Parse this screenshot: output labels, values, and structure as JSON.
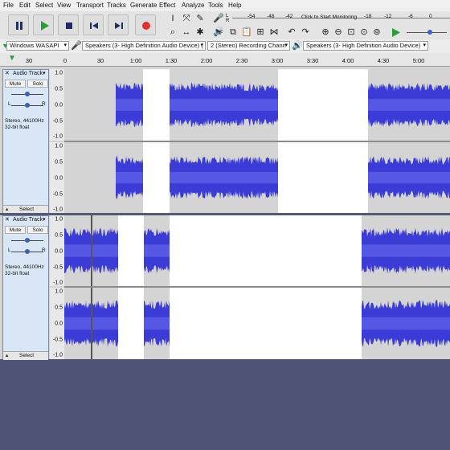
{
  "menu": [
    "File",
    "Edit",
    "Select",
    "View",
    "Transport",
    "Tracks",
    "Generate",
    "Effect",
    "Analyze",
    "Tools",
    "Help"
  ],
  "meter": {
    "click_text": "Click to Start Monitoring",
    "scale": [
      "-54",
      "-48",
      "-42",
      "-18",
      "-12",
      "-6",
      "0"
    ],
    "left_label": "L",
    "right_label": "R"
  },
  "device": {
    "host": "Windows WASAPI",
    "recording": "Speakers (3- High Definition Audio Device) (",
    "channels": "2 (Stereo) Recording Chann",
    "playback": "Speakers (3- High Definition Audio Device)"
  },
  "timeline": {
    "ticks": [
      "30",
      "0",
      "30",
      "1:00",
      "1:30",
      "2:00",
      "2:30",
      "3:00",
      "3:30",
      "4:00",
      "4:30",
      "5:00"
    ]
  },
  "tracks": [
    {
      "name": "Audio Track",
      "mute": "Mute",
      "solo": "Solo",
      "info1": "Stereo, 44100Hz",
      "info2": "32-bit float",
      "select": "Select",
      "gain_l": "L",
      "gain_r": "R",
      "scale": [
        "1.0",
        "0.5",
        "0.0",
        "-0.5",
        "-1.0"
      ]
    },
    {
      "name": "Audio Track",
      "mute": "Mute",
      "solo": "Solo",
      "info1": "Stereo, 44100Hz",
      "info2": "32-bit float",
      "select": "Select",
      "gain_l": "L",
      "gain_r": "R",
      "scale": [
        "1.0",
        "0.5",
        "0.0",
        "-0.5",
        "-1.0"
      ]
    }
  ],
  "colors": {
    "wave": "#3b3bd6",
    "wave_light": "#6a6aee",
    "clip_bg": "#d4d4d4",
    "selected_bg": "#ffffff",
    "accent": "#2a9d3b",
    "record": "#e03030"
  }
}
